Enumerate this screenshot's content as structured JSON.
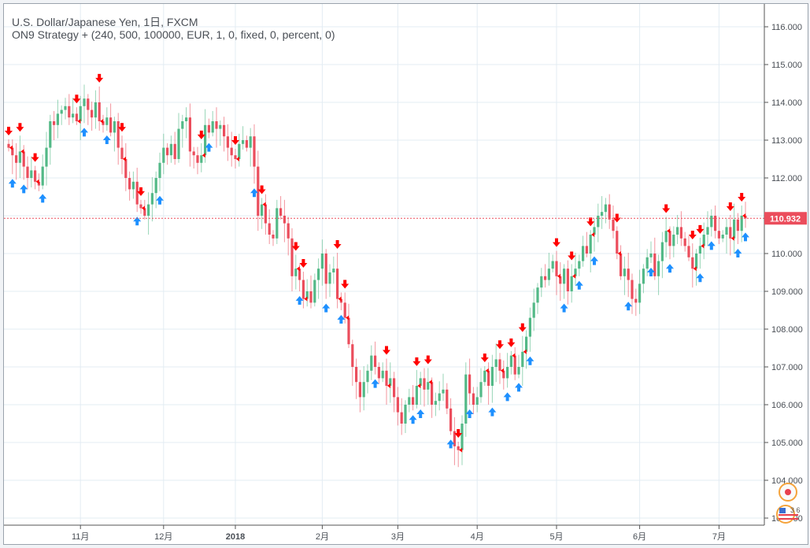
{
  "header": {
    "symbol_line": "U.S. Dollar/Japanese Yen, 1日, FXCM",
    "strategy_line": "ON9 Strategy + (240, 500, 100000, EUR, 1, 0, fixed, 0, percent, 0)"
  },
  "badge": {
    "label": "3 6"
  },
  "chart_data": {
    "type": "candlestick",
    "title": "U.S. Dollar/Japanese Yen, 1日, FXCM",
    "ylim": [
      102.8,
      116.4
    ],
    "y_ticks": [
      "116.000",
      "115.000",
      "114.000",
      "113.000",
      "112.000",
      "111.000",
      "110.000",
      "109.000",
      "108.000",
      "107.000",
      "106.000",
      "105.000",
      "104.000",
      "103.000"
    ],
    "x_ticks": [
      {
        "label": "11月",
        "bar": 19
      },
      {
        "label": "12月",
        "bar": 41
      },
      {
        "label": "2018",
        "bar": 60
      },
      {
        "label": "2月",
        "bar": 83
      },
      {
        "label": "3月",
        "bar": 103
      },
      {
        "label": "4月",
        "bar": 124
      },
      {
        "label": "5月",
        "bar": 145
      },
      {
        "label": "6月",
        "bar": 167
      },
      {
        "label": "7月",
        "bar": 188
      }
    ],
    "last_price": "110.932",
    "first_open": 112.9,
    "closes": [
      112.8,
      112.6,
      112.4,
      112.7,
      112.3,
      112.0,
      112.2,
      111.9,
      111.8,
      112.3,
      112.8,
      113.5,
      113.4,
      113.7,
      113.8,
      113.9,
      113.6,
      113.7,
      113.5,
      113.9,
      114.1,
      113.8,
      113.6,
      114.0,
      113.5,
      113.4,
      113.6,
      113.2,
      113.5,
      112.8,
      112.5,
      112.0,
      111.7,
      111.9,
      111.3,
      111.2,
      111.0,
      111.3,
      111.6,
      112.0,
      112.4,
      112.8,
      112.6,
      112.9,
      112.5,
      113.3,
      113.5,
      113.6,
      112.7,
      112.6,
      112.4,
      112.6,
      113.4,
      113.2,
      113.5,
      113.3,
      113.4,
      113.1,
      112.8,
      112.6,
      112.5,
      112.9,
      113.0,
      112.8,
      113.1,
      112.3,
      111.0,
      111.3,
      110.8,
      110.5,
      110.4,
      111.2,
      111.0,
      110.8,
      110.4,
      109.4,
      109.6,
      109.3,
      108.8,
      109.0,
      108.7,
      109.3,
      109.6,
      110.0,
      109.2,
      109.5,
      109.6,
      108.8,
      108.7,
      108.3,
      107.6,
      107.0,
      106.6,
      106.2,
      106.6,
      106.9,
      107.3,
      107.0,
      106.7,
      106.9,
      106.5,
      106.7,
      106.2,
      105.8,
      105.5,
      106.0,
      106.2,
      106.0,
      106.5,
      106.7,
      106.4,
      106.6,
      106.0,
      106.1,
      106.3,
      106.4,
      105.9,
      105.3,
      104.9,
      104.8,
      105.5,
      106.8,
      106.3,
      106.0,
      106.2,
      106.6,
      106.9,
      106.5,
      107.0,
      107.2,
      106.9,
      106.7,
      107.0,
      107.3,
      106.8,
      107.0,
      107.4,
      107.8,
      108.3,
      108.7,
      109.1,
      109.4,
      109.3,
      109.6,
      109.8,
      109.4,
      109.2,
      109.6,
      109.0,
      109.4,
      109.6,
      109.8,
      110.2,
      110.0,
      110.5,
      110.7,
      111.0,
      111.1,
      111.3,
      110.9,
      110.6,
      110.0,
      109.4,
      109.6,
      109.3,
      108.8,
      108.7,
      109.2,
      109.6,
      109.9,
      110.0,
      109.4,
      109.8,
      110.3,
      110.6,
      110.2,
      110.5,
      110.7,
      110.4,
      110.2,
      109.9,
      109.6,
      110.0,
      110.2,
      110.5,
      110.7,
      111.0,
      110.6,
      110.4,
      110.5,
      110.7,
      110.4,
      110.9,
      110.6,
      111.0,
      110.93
    ],
    "sell_signals": [
      0,
      3,
      7,
      18,
      24,
      30,
      35,
      51,
      60,
      67,
      76,
      78,
      87,
      89,
      100,
      108,
      111,
      119,
      126,
      130,
      133,
      136,
      145,
      149,
      154,
      161,
      174,
      181,
      183,
      191,
      194
    ],
    "buy_signals": [
      1,
      4,
      9,
      20,
      26,
      34,
      40,
      53,
      65,
      77,
      84,
      88,
      97,
      107,
      109,
      117,
      122,
      128,
      132,
      135,
      138,
      147,
      151,
      155,
      164,
      170,
      175,
      183,
      186,
      193,
      195
    ],
    "colors": {
      "up": "#53b987",
      "down": "#eb4d5c",
      "sell": "#ff0000",
      "buy": "#1e90ff",
      "grid": "#e3ecf3",
      "last": "#eb4d5c"
    }
  }
}
